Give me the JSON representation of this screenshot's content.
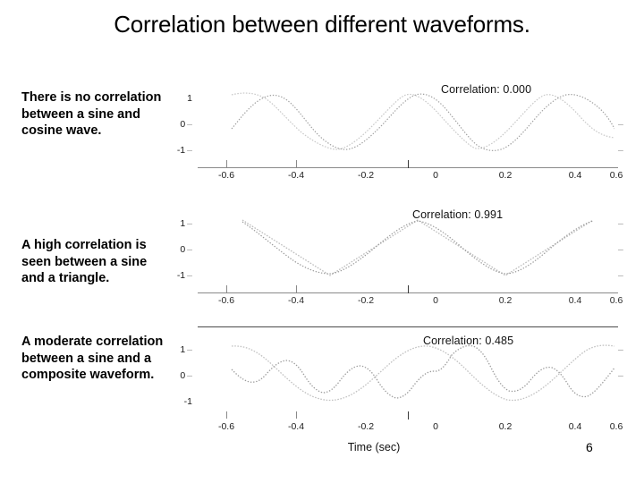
{
  "slide": {
    "title": "Correlation between different waveforms.",
    "page_number": "6"
  },
  "captions": [
    {
      "id": "caption-1",
      "text": "There is no correlation between a sine and cosine wave."
    },
    {
      "id": "caption-2",
      "text": "A high correlation is seen between a sine and a triangle."
    },
    {
      "id": "caption-3",
      "text": "A moderate correlation between a sine and a composite waveform."
    }
  ],
  "figure": {
    "x_axis_title": "Time (sec)",
    "y_ticks": [
      "1",
      "0",
      "-1"
    ],
    "x_ticks": [
      "-0.6",
      "-0.4",
      "-0.2",
      "0",
      "0.2",
      "0.4",
      "0.6"
    ],
    "panels": [
      {
        "name": "sine-vs-cosine",
        "correlation_label": "Correlation: 0.000",
        "correlation_value": 0.0
      },
      {
        "name": "sine-vs-triangle",
        "correlation_label": "Correlation: 0.991",
        "correlation_value": 0.991
      },
      {
        "name": "sine-vs-composite",
        "correlation_label": "Correlation: 0.485",
        "correlation_value": 0.485
      }
    ]
  },
  "chart_data": {
    "type": "line",
    "title": "Correlation between different waveforms.",
    "xlabel": "Time (sec)",
    "ylabel": "",
    "xlim": [
      -0.6,
      0.6
    ],
    "ylim": [
      -1.3,
      1.3
    ],
    "xticks": [
      -0.6,
      -0.4,
      -0.2,
      0,
      0.2,
      0.4,
      0.6
    ],
    "yticks": [
      -1,
      0,
      1
    ],
    "grid": false,
    "legend": "none",
    "subplots": [
      {
        "name": "sine-vs-cosine",
        "annotation": "Correlation: 0.000",
        "correlation": 0.0,
        "series": [
          {
            "name": "sine",
            "form": "sin",
            "amplitude": 1,
            "frequency_hz": 2,
            "phase_deg": 0
          },
          {
            "name": "cosine",
            "form": "cos",
            "amplitude": 1,
            "frequency_hz": 2,
            "phase_deg": 90
          }
        ]
      },
      {
        "name": "sine-vs-triangle",
        "annotation": "Correlation: 0.991",
        "correlation": 0.991,
        "series": [
          {
            "name": "sine",
            "form": "sin",
            "amplitude": 1,
            "frequency_hz": 2,
            "phase_deg": 90
          },
          {
            "name": "triangle",
            "form": "triangle",
            "amplitude": 1,
            "frequency_hz": 2,
            "phase_deg": 90
          }
        ]
      },
      {
        "name": "sine-vs-composite",
        "annotation": "Correlation: 0.485",
        "correlation": 0.485,
        "series": [
          {
            "name": "sine",
            "form": "sin",
            "amplitude": 1,
            "frequency_hz": 2,
            "phase_deg": 90
          },
          {
            "name": "composite",
            "form": "sin+harmonic",
            "amplitude": 1,
            "frequency_hz": 2,
            "harmonic_hz": 6,
            "harmonic_amplitude": 0.45,
            "phase_deg": 90
          }
        ]
      }
    ]
  }
}
